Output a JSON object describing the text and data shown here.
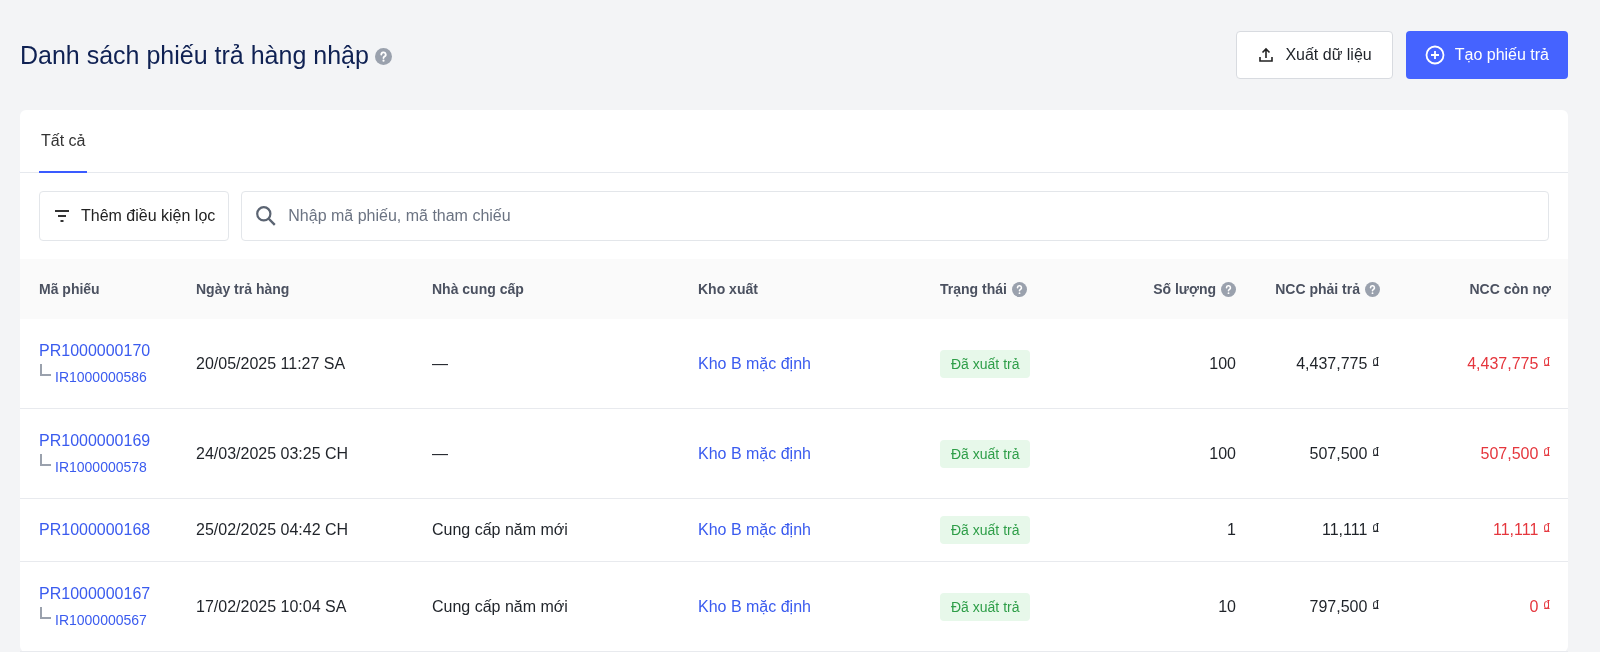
{
  "page": {
    "title": "Danh sách phiếu trả hàng nhập"
  },
  "actions": [
    {
      "kind": "export",
      "label": "Xuất dữ liệu"
    },
    {
      "kind": "create",
      "label": "Tạo phiếu trả"
    }
  ],
  "tabs": [
    {
      "label": "Tất cả",
      "selected": true
    }
  ],
  "filter": {
    "label": "Thêm điều kiện lọc"
  },
  "search": {
    "placeholder": "Nhập mã phiếu, mã tham chiếu"
  },
  "table": {
    "columns": [
      {
        "label": "Mã phiếu",
        "help": false
      },
      {
        "label": "Ngày trả hàng",
        "help": false
      },
      {
        "label": "Nhà cung cấp",
        "help": false
      },
      {
        "label": "Kho xuất",
        "help": false
      },
      {
        "label": "Trạng thái",
        "help": true
      },
      {
        "label": "Số lượng",
        "help": true
      },
      {
        "label": "NCC phải trả",
        "help": true
      },
      {
        "label": "NCC còn nợ",
        "help": false
      }
    ],
    "rows": [
      {
        "code": "PR1000000170",
        "ref": "IR1000000586",
        "date": "20/05/2025 11:27 SA",
        "supplier": "—",
        "warehouse": "Kho B mặc định",
        "status": "Đã xuất trả",
        "quantity": "100",
        "payable": "4,437,775 ₫",
        "debt": "4,437,775 ₫"
      },
      {
        "code": "PR1000000169",
        "ref": "IR1000000578",
        "date": "24/03/2025 03:25 CH",
        "supplier": "—",
        "warehouse": "Kho B mặc định",
        "status": "Đã xuất trả",
        "quantity": "100",
        "payable": "507,500 ₫",
        "debt": "507,500 ₫"
      },
      {
        "code": "PR1000000168",
        "date": "25/02/2025 04:42 CH",
        "supplier": "Cung cấp năm mới",
        "warehouse": "Kho B mặc định",
        "status": "Đã xuất trả",
        "quantity": "1",
        "payable": "11,111 ₫",
        "debt": "11,111 ₫"
      },
      {
        "code": "PR1000000167",
        "ref": "IR1000000567",
        "date": "17/02/2025 10:04 SA",
        "supplier": "Cung cấp năm mới",
        "warehouse": "Kho B mặc định",
        "status": "Đã xuất trả",
        "quantity": "10",
        "payable": "797,500 ₫",
        "debt": "0 ₫"
      }
    ]
  }
}
